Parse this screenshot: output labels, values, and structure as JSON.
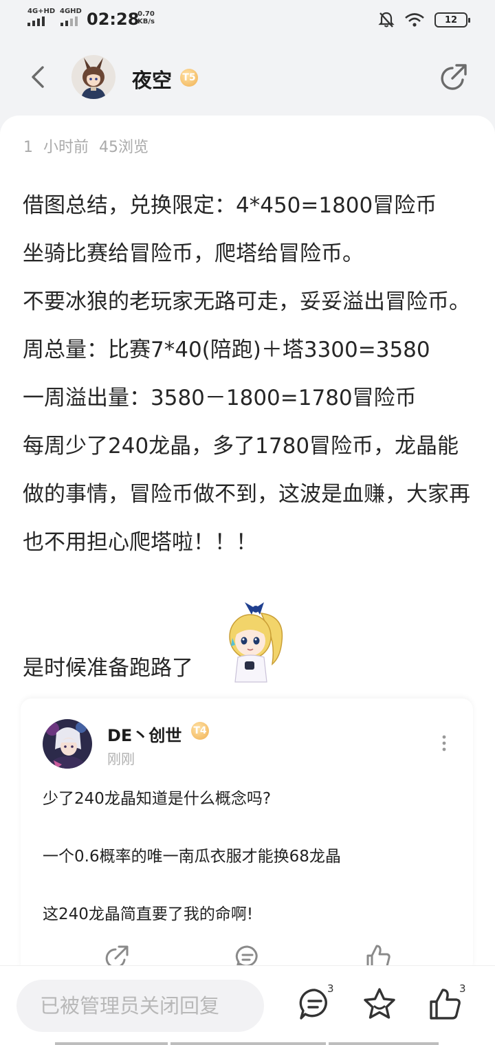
{
  "status_bar": {
    "net1": "4G+HD",
    "net2": "4GHD",
    "time": "02:28",
    "speed_value": "0.70",
    "speed_unit": "KB/s",
    "battery": "12"
  },
  "header": {
    "username": "夜空",
    "level": "T5"
  },
  "post": {
    "meta": "1 小时前  45浏览",
    "paragraphs": [
      "借图总结，兑换限定：4*450=1800冒险币",
      "坐骑比赛给冒险币，爬塔给冒险币。",
      "不要冰狼的老玩家无路可走，妥妥溢出冒险币。",
      "周总量：比赛7*40(陪跑)＋塔3300=3580",
      "一周溢出量：3580－1800=1780冒险币",
      "每周少了240龙晶，多了1780冒险币，龙晶能做的事情，冒险币做不到，这波是血赚，大家再也不用担心爬塔啦！！！"
    ],
    "closing": "是时候准备跑路了"
  },
  "comment": {
    "username": "DE丶创世",
    "level": "T4",
    "time": "刚刚",
    "lines": [
      "少了240龙晶知道是什么概念吗?",
      "一个0.6概率的唯一南瓜衣服才能换68龙晶",
      "这240龙晶简直要了我的命啊!"
    ]
  },
  "bottom_bar": {
    "reply_placeholder": "已被管理员关闭回复",
    "comment_count": "3",
    "like_count": "3"
  },
  "colors": {
    "background": "#f2f3f5",
    "card": "#ffffff",
    "level_badge": "#f0b052",
    "muted_text": "#aaaaaa"
  }
}
